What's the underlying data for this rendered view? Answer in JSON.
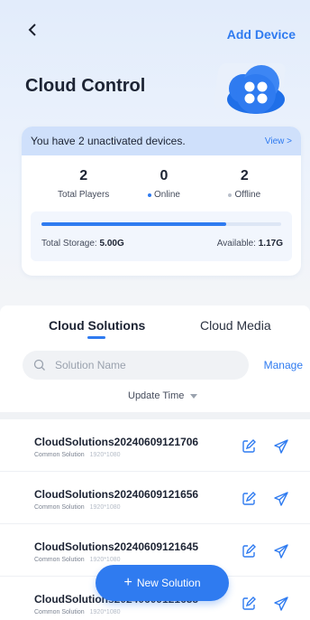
{
  "header": {
    "back_icon": "chevron-left-icon",
    "add_device_label": "Add Device",
    "title": "Cloud Control"
  },
  "summary": {
    "banner_text": "You have 2 unactivated devices.",
    "view_label": "View >",
    "stats": [
      {
        "value": "2",
        "label": "Total Players"
      },
      {
        "value": "0",
        "label": "Online"
      },
      {
        "value": "2",
        "label": "Offline"
      }
    ],
    "storage": {
      "total_label": "Total Storage:",
      "total_value": "5.00G",
      "available_label": "Available:",
      "available_value": "1.17G",
      "used_fraction": 0.77
    }
  },
  "tabs": [
    {
      "label": "Cloud Solutions",
      "active": true
    },
    {
      "label": "Cloud Media",
      "active": false
    }
  ],
  "search": {
    "placeholder": "Solution Name",
    "manage_label": "Manage"
  },
  "sort": {
    "label": "Update Time"
  },
  "solutions": [
    {
      "name": "CloudSolutions20240609121706",
      "type": "Common Solution",
      "resolution": "1920*1080"
    },
    {
      "name": "CloudSolutions20240609121656",
      "type": "Common Solution",
      "resolution": "1920*1080"
    },
    {
      "name": "CloudSolutions20240609121645",
      "type": "Common Solution",
      "resolution": "1920*1080"
    },
    {
      "name": "CloudSolutions20240609121635",
      "type": "Common Solution",
      "resolution": "1920*1080"
    }
  ],
  "fab": {
    "label": "New Solution"
  },
  "colors": {
    "accent": "#2f7bf0",
    "online_dot": "#2f7bf0",
    "offline_dot": "#b9c0cb"
  }
}
